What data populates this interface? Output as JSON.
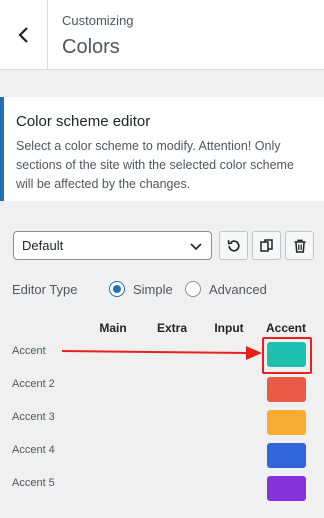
{
  "header": {
    "breadcrumb": "Customizing",
    "title": "Colors"
  },
  "description": {
    "title": "Color scheme editor",
    "text": "Select a color scheme to modify. Attention! Only sections of the site with the selected color scheme will be affected by the changes."
  },
  "scheme_select": {
    "value": "Default"
  },
  "toolbar": {
    "icons": [
      "reset-icon",
      "copy-icon",
      "delete-icon"
    ]
  },
  "editor_type": {
    "label": "Editor Type",
    "options": [
      {
        "label": "Simple",
        "checked": true
      },
      {
        "label": "Advanced",
        "checked": false
      }
    ]
  },
  "columns": [
    "Main",
    "Extra",
    "Input",
    "Accent"
  ],
  "rows": [
    {
      "label": "Accent",
      "color": "#20c0b0"
    },
    {
      "label": "Accent 2",
      "color": "#ea5a47"
    },
    {
      "label": "Accent 3",
      "color": "#f8ad32"
    },
    {
      "label": "Accent 4",
      "color": "#3264dc"
    },
    {
      "label": "Accent 5",
      "color": "#8333d9"
    }
  ],
  "colors": {
    "accent_blue": "#2271b1",
    "annotation_red": "#e8201b"
  }
}
